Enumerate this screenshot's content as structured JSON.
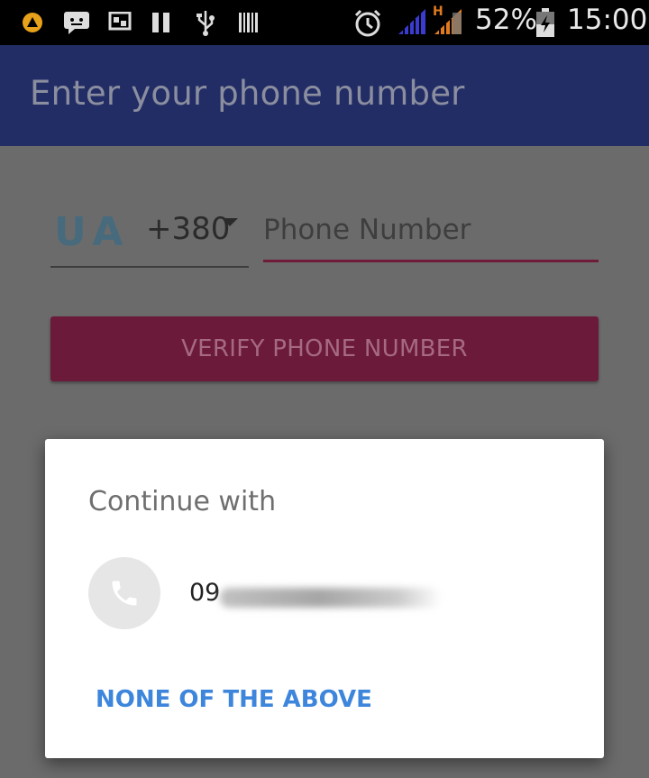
{
  "status_bar": {
    "icons": [
      "app-warning-icon",
      "message-icon",
      "cast-icon",
      "pause-icon",
      "usb-icon",
      "barcode-icon",
      "alarm-icon",
      "signal-icon",
      "signal-h-icon",
      "battery-icon"
    ],
    "network_type": "H",
    "battery_percent": "52%",
    "time": "15:00"
  },
  "app_bar": {
    "title": "Enter your phone number"
  },
  "form": {
    "country_code": "UA",
    "dial_code": "+380",
    "phone_placeholder": "Phone Number",
    "phone_value": "",
    "verify_label": "VERIFY PHONE NUMBER"
  },
  "dialog": {
    "title": "Continue with",
    "account_number_prefix": "09",
    "none_label": "NONE OF THE ABOVE"
  },
  "colors": {
    "app_bar": "#222d65",
    "accent": "#6c1a3a",
    "link": "#3d86dc",
    "dialog_bg": "#ffffff"
  }
}
